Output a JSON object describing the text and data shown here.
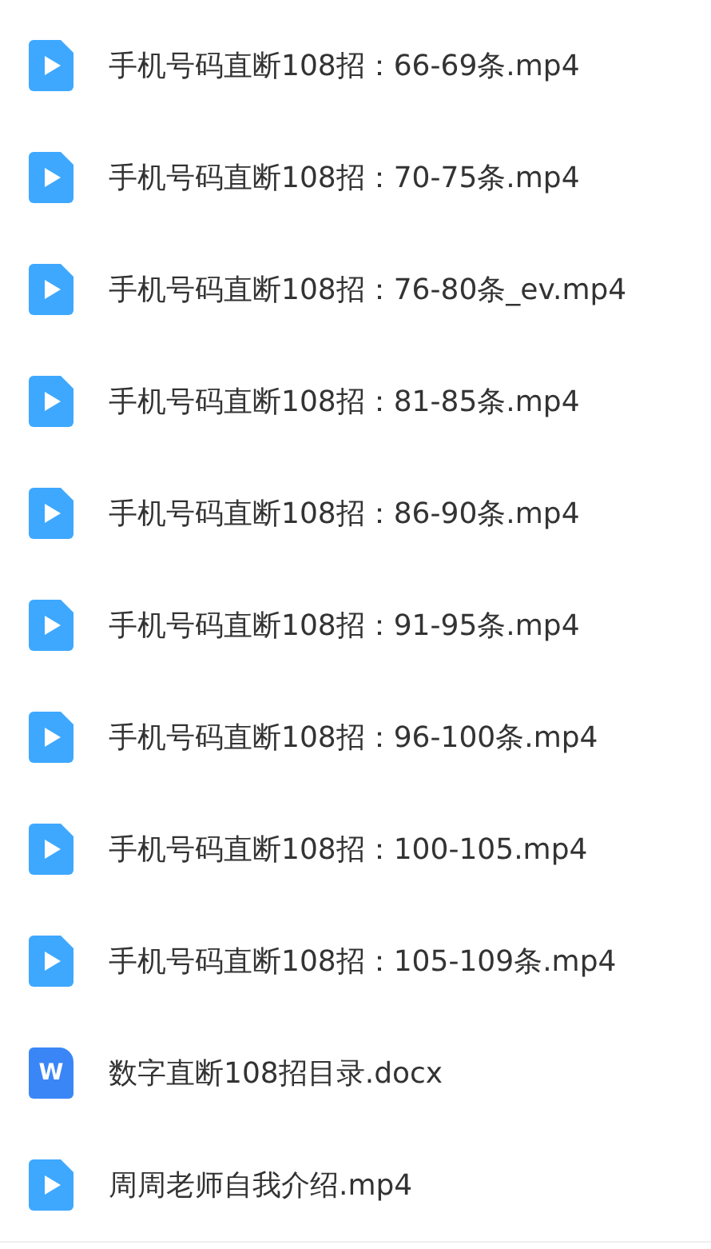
{
  "files": [
    {
      "kind": "video",
      "name": "手机号码直断108招：66-69条.mp4"
    },
    {
      "kind": "video",
      "name": "手机号码直断108招：70-75条.mp4"
    },
    {
      "kind": "video",
      "name": "手机号码直断108招：76-80条_ev.mp4"
    },
    {
      "kind": "video",
      "name": "手机号码直断108招：81-85条.mp4"
    },
    {
      "kind": "video",
      "name": "手机号码直断108招：86-90条.mp4"
    },
    {
      "kind": "video",
      "name": "手机号码直断108招：91-95条.mp4"
    },
    {
      "kind": "video",
      "name": "手机号码直断108招：96-100条.mp4"
    },
    {
      "kind": "video",
      "name": "手机号码直断108招：100-105.mp4"
    },
    {
      "kind": "video",
      "name": "手机号码直断108招：105-109条.mp4"
    },
    {
      "kind": "doc",
      "name": "数字直断108招目录.docx",
      "icon_letter": "W"
    },
    {
      "kind": "video",
      "name": "周周老师自我介绍.mp4"
    }
  ]
}
